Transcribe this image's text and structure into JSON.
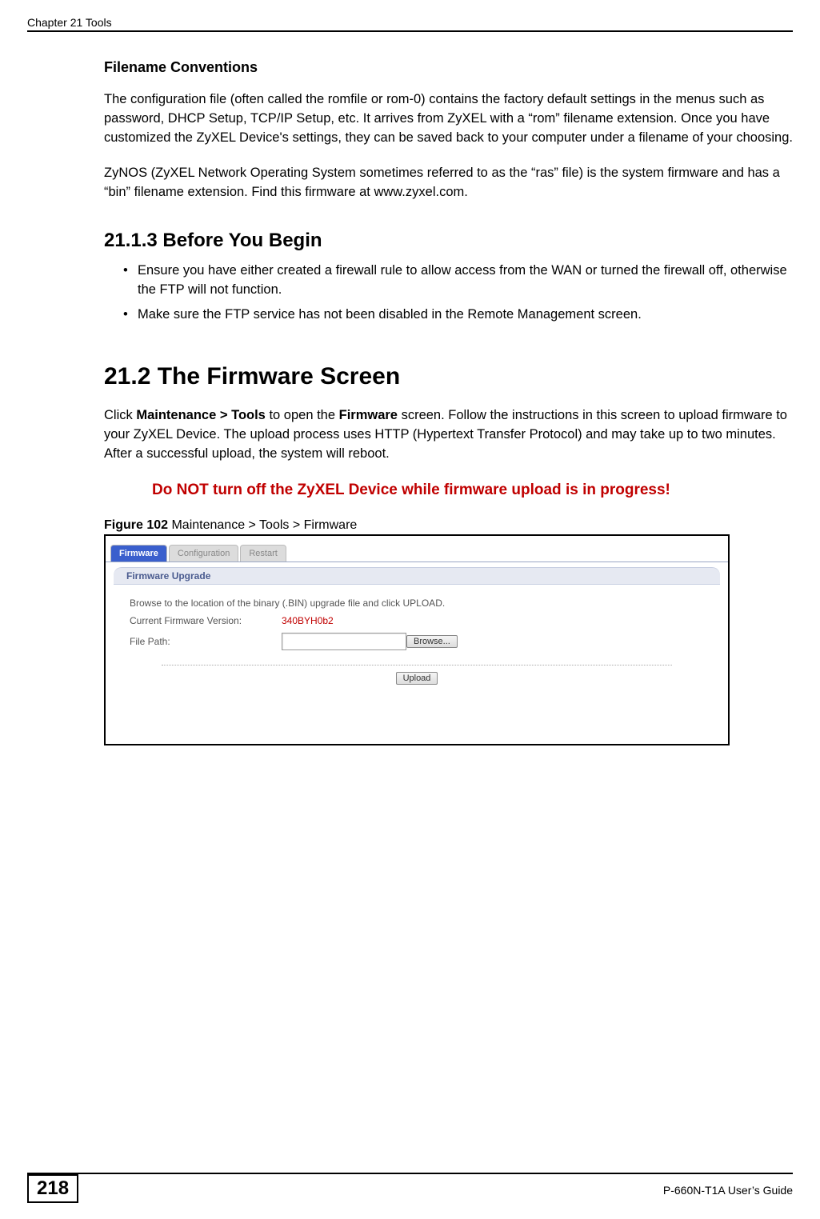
{
  "header": {
    "chapter": "Chapter 21 Tools"
  },
  "section_filename": {
    "title": "Filename Conventions",
    "para1": "The configuration file (often called the romfile or rom-0) contains the factory default settings in the menus such as password, DHCP Setup, TCP/IP Setup, etc. It arrives from ZyXEL with a “rom” filename extension. Once you have customized the ZyXEL Device's settings, they can be saved back to your computer under a filename of your choosing.",
    "para2": "ZyNOS (ZyXEL Network Operating System sometimes referred to as the “ras” file) is the system firmware and has a “bin” filename extension. Find this firmware at www.zyxel.com."
  },
  "section_before": {
    "heading": "21.1.3  Before You Begin",
    "bullets": [
      "Ensure you have either created a firewall rule to allow access from the WAN or turned the firewall off, otherwise the FTP will not function.",
      "Make sure the FTP service has not been disabled in the Remote Management screen."
    ]
  },
  "section_firmware": {
    "heading": "21.2  The Firmware Screen",
    "intro_pre": "Click ",
    "intro_bold1": "Maintenance > Tools",
    "intro_mid1": " to open the ",
    "intro_bold2": "Firmware",
    "intro_mid2": " screen. Follow the instructions in this screen to upload firmware to your ZyXEL Device. The upload process uses HTTP (Hypertext Transfer Protocol) and may take up to two minutes. After a successful upload, the system will reboot.",
    "warning": "Do NOT turn off the ZyXEL Device while firmware upload is in progress!"
  },
  "figure": {
    "label": "Figure 102",
    "caption_rest": "   Maintenance > Tools > Firmware"
  },
  "screenshot": {
    "tabs": [
      "Firmware",
      "Configuration",
      "Restart"
    ],
    "panel_title": "Firmware Upgrade",
    "instruction": "Browse to the location of the binary (.BIN) upgrade file and click UPLOAD.",
    "version_label": "Current Firmware Version:",
    "version_value": "340BYH0b2",
    "filepath_label": "File Path:",
    "browse_btn": "Browse...",
    "upload_btn": "Upload"
  },
  "footer": {
    "page_number": "218",
    "guide": "P-660N-T1A User’s Guide"
  }
}
